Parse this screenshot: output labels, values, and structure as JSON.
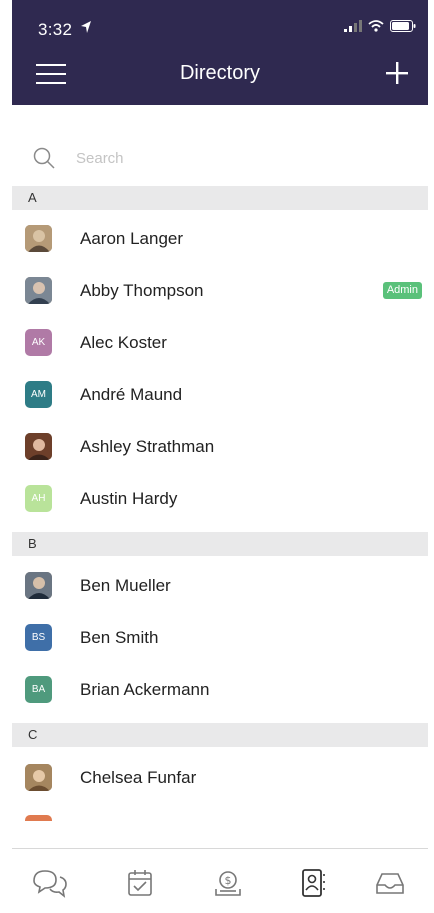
{
  "status_bar": {
    "time": "3:32"
  },
  "nav": {
    "title": "Directory"
  },
  "search": {
    "placeholder": "Search"
  },
  "sections": [
    {
      "letter": "A",
      "contacts": [
        {
          "name": "Aaron Langer",
          "initials": "",
          "avatar_color": "#8a7a68"
        },
        {
          "name": "Abby Thompson",
          "initials": "",
          "avatar_color": "#6a7480",
          "badge": "Admin"
        },
        {
          "name": "Alec Koster",
          "initials": "AK",
          "avatar_color": "#b07aa6"
        },
        {
          "name": "André Maund",
          "initials": "AM",
          "avatar_color": "#2e7c86"
        },
        {
          "name": "Ashley Strathman",
          "initials": "",
          "avatar_color": "#7a4d35"
        },
        {
          "name": "Austin Hardy",
          "initials": "AH",
          "avatar_color": "#b9e39a"
        }
      ]
    },
    {
      "letter": "B",
      "contacts": [
        {
          "name": "Ben Mueller",
          "initials": "",
          "avatar_color": "#4c5562"
        },
        {
          "name": "Ben Smith",
          "initials": "BS",
          "avatar_color": "#3f6fa8"
        },
        {
          "name": "Brian Ackermann",
          "initials": "BA",
          "avatar_color": "#4f9a7d"
        }
      ]
    },
    {
      "letter": "C",
      "contacts": [
        {
          "name": "Chelsea Funfar",
          "initials": "",
          "avatar_color": "#9b7a5a"
        }
      ]
    }
  ],
  "colors": {
    "header_bg": "#2f2950",
    "badge_green": "#5ac17a",
    "section_bg": "#e9e9ea"
  },
  "tabs": [
    {
      "icon": "chat-icon"
    },
    {
      "icon": "calendar-icon"
    },
    {
      "icon": "money-bag-icon"
    },
    {
      "icon": "contacts-icon",
      "active": true
    },
    {
      "icon": "inbox-icon"
    }
  ]
}
